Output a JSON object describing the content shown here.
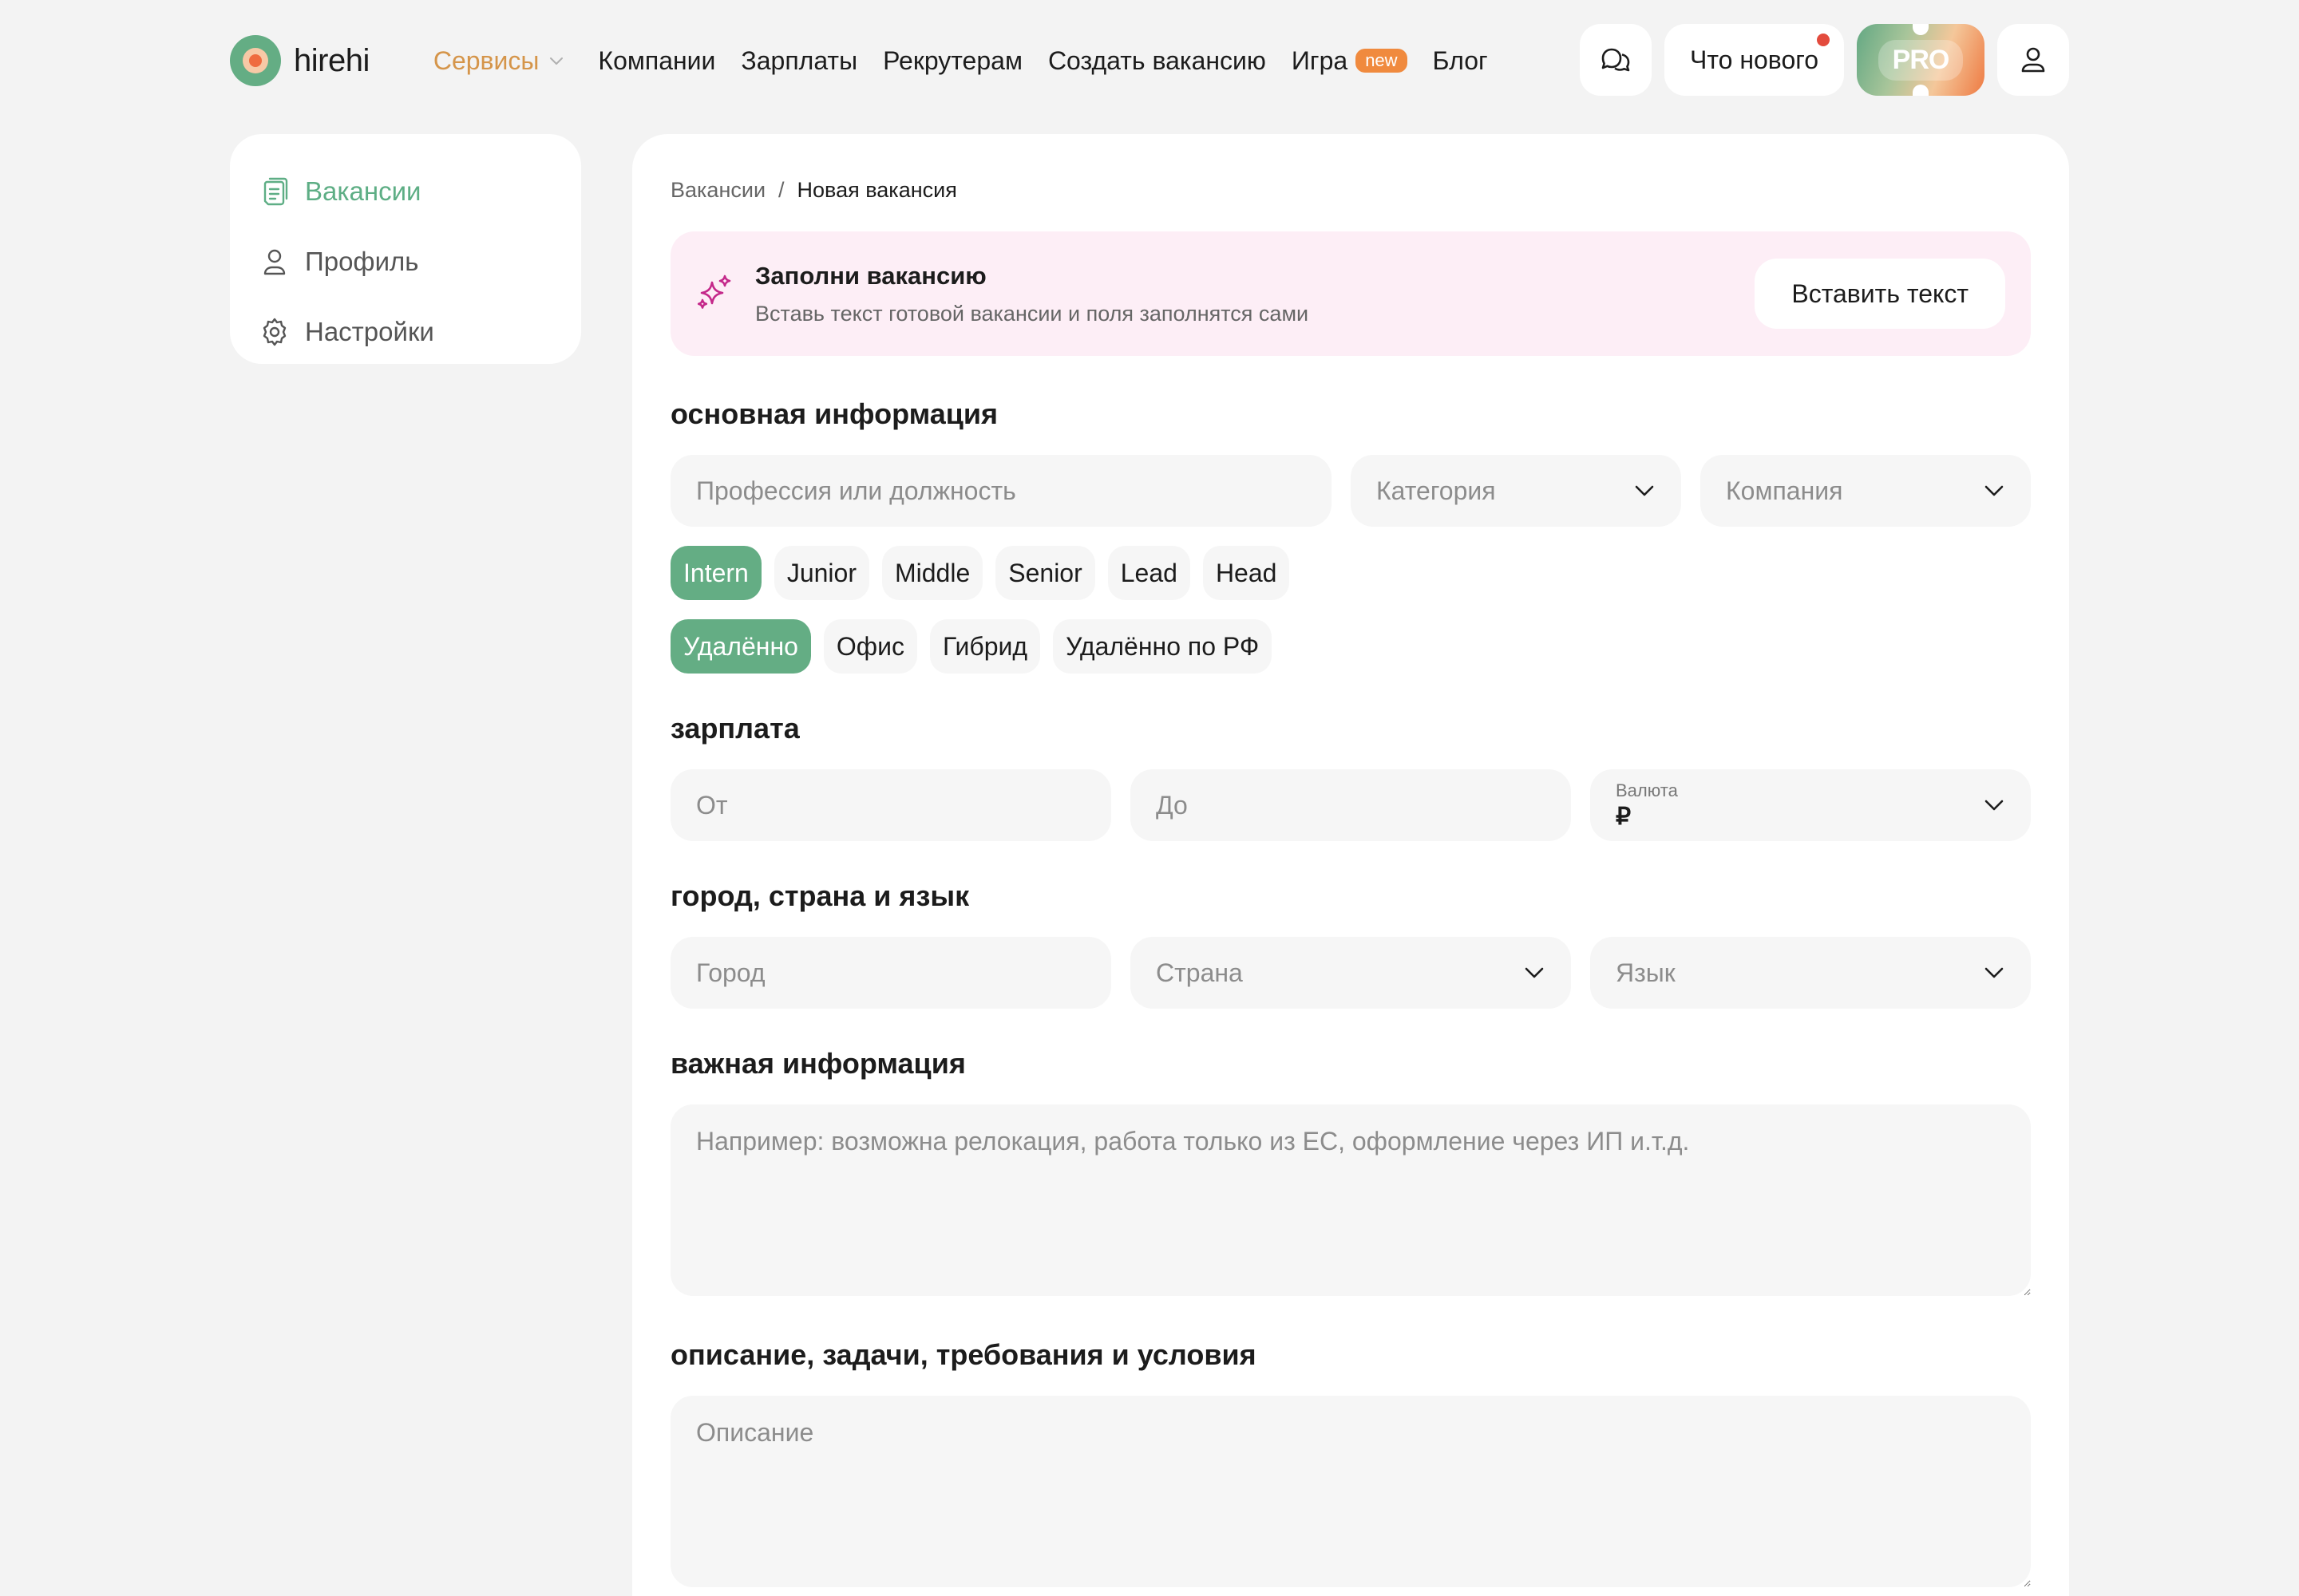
{
  "header": {
    "logo_text": "hirehi",
    "nav": {
      "services": "Сервисы",
      "companies": "Компании",
      "salaries": "Зарплаты",
      "recruiters": "Рекрутерам",
      "create_vacancy": "Создать вакансию",
      "game": "Игра",
      "game_badge": "new",
      "blog": "Блог"
    },
    "whats_new": "Что нового",
    "pro": "PRO",
    "accent_color": "#64ad84",
    "services_color": "#d5954a"
  },
  "sidebar": {
    "items": [
      {
        "label": "Вакансии",
        "icon": "vacancies-icon",
        "active": true
      },
      {
        "label": "Профиль",
        "icon": "profile-icon",
        "active": false
      },
      {
        "label": "Настройки",
        "icon": "settings-gear-icon",
        "active": false
      }
    ]
  },
  "breadcrumb": {
    "parent": "Вакансии",
    "separator": "/",
    "current": "Новая вакансия"
  },
  "promo": {
    "title": "Заполни вакансию",
    "subtitle": "Вставь текст готовой вакансии и поля заполнятся сами",
    "button": "Вставить текст",
    "background": "#fdeef6"
  },
  "basic_info": {
    "title": "основная информация",
    "profession_placeholder": "Профессия или должность",
    "category_placeholder": "Категория",
    "company_placeholder": "Компания",
    "grades": [
      "Intern",
      "Junior",
      "Middle",
      "Senior",
      "Lead",
      "Head"
    ],
    "selected_grade": "Intern",
    "formats": [
      "Удалённо",
      "Офис",
      "Гибрид",
      "Удалённо по РФ"
    ],
    "selected_format": "Удалённо"
  },
  "salary": {
    "title": "зарплата",
    "from_placeholder": "От",
    "to_placeholder": "До",
    "currency_label": "Валюта",
    "currency_value": "₽"
  },
  "location": {
    "title": "город, страна и язык",
    "city_placeholder": "Город",
    "country_placeholder": "Страна",
    "language_placeholder": "Язык"
  },
  "important": {
    "title": "важная информация",
    "placeholder": "Например: возможна релокация, работа только из ЕС, оформление через ИП и.т.д."
  },
  "description": {
    "title": "описание, задачи, требования и условия",
    "placeholder": "Описание"
  }
}
